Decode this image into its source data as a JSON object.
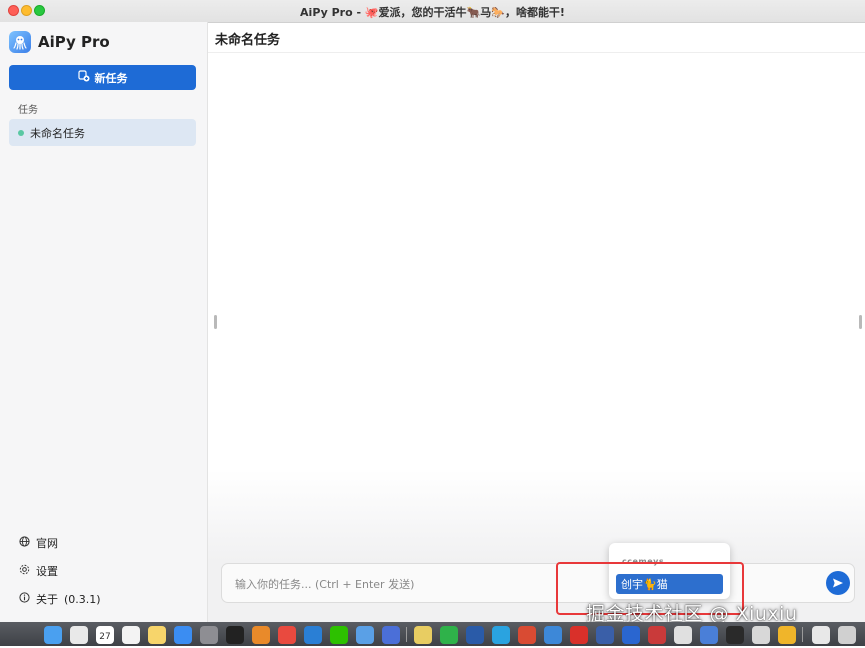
{
  "window": {
    "title": "AiPy Pro - 🐙爱派，您的干活牛🐂马🐎，啥都能干!"
  },
  "sidebar": {
    "app_name": "AiPy Pro",
    "new_task_label": "新任务",
    "section_label": "任务",
    "tasks": [
      {
        "label": "未命名任务",
        "status_color": "#5ac8a3"
      }
    ],
    "links": {
      "website": "官网",
      "settings": "设置",
      "about": "关于",
      "version": "(0.3.1)"
    }
  },
  "main": {
    "title": "未命名任务",
    "input": {
      "placeholder": "输入你的任务... (Ctrl + Enter 发送)"
    },
    "send_icon": "send-icon"
  },
  "ime": {
    "composition": "ccemeys",
    "candidate": "创宇🐈猫"
  },
  "watermark": "掘金技术社区 @ Xiuxiu",
  "dock": {
    "calendar_day": "27"
  },
  "colors": {
    "accent": "#1e6bd6",
    "task_active_bg": "#dde7f3",
    "highlight": "#e8383a"
  }
}
